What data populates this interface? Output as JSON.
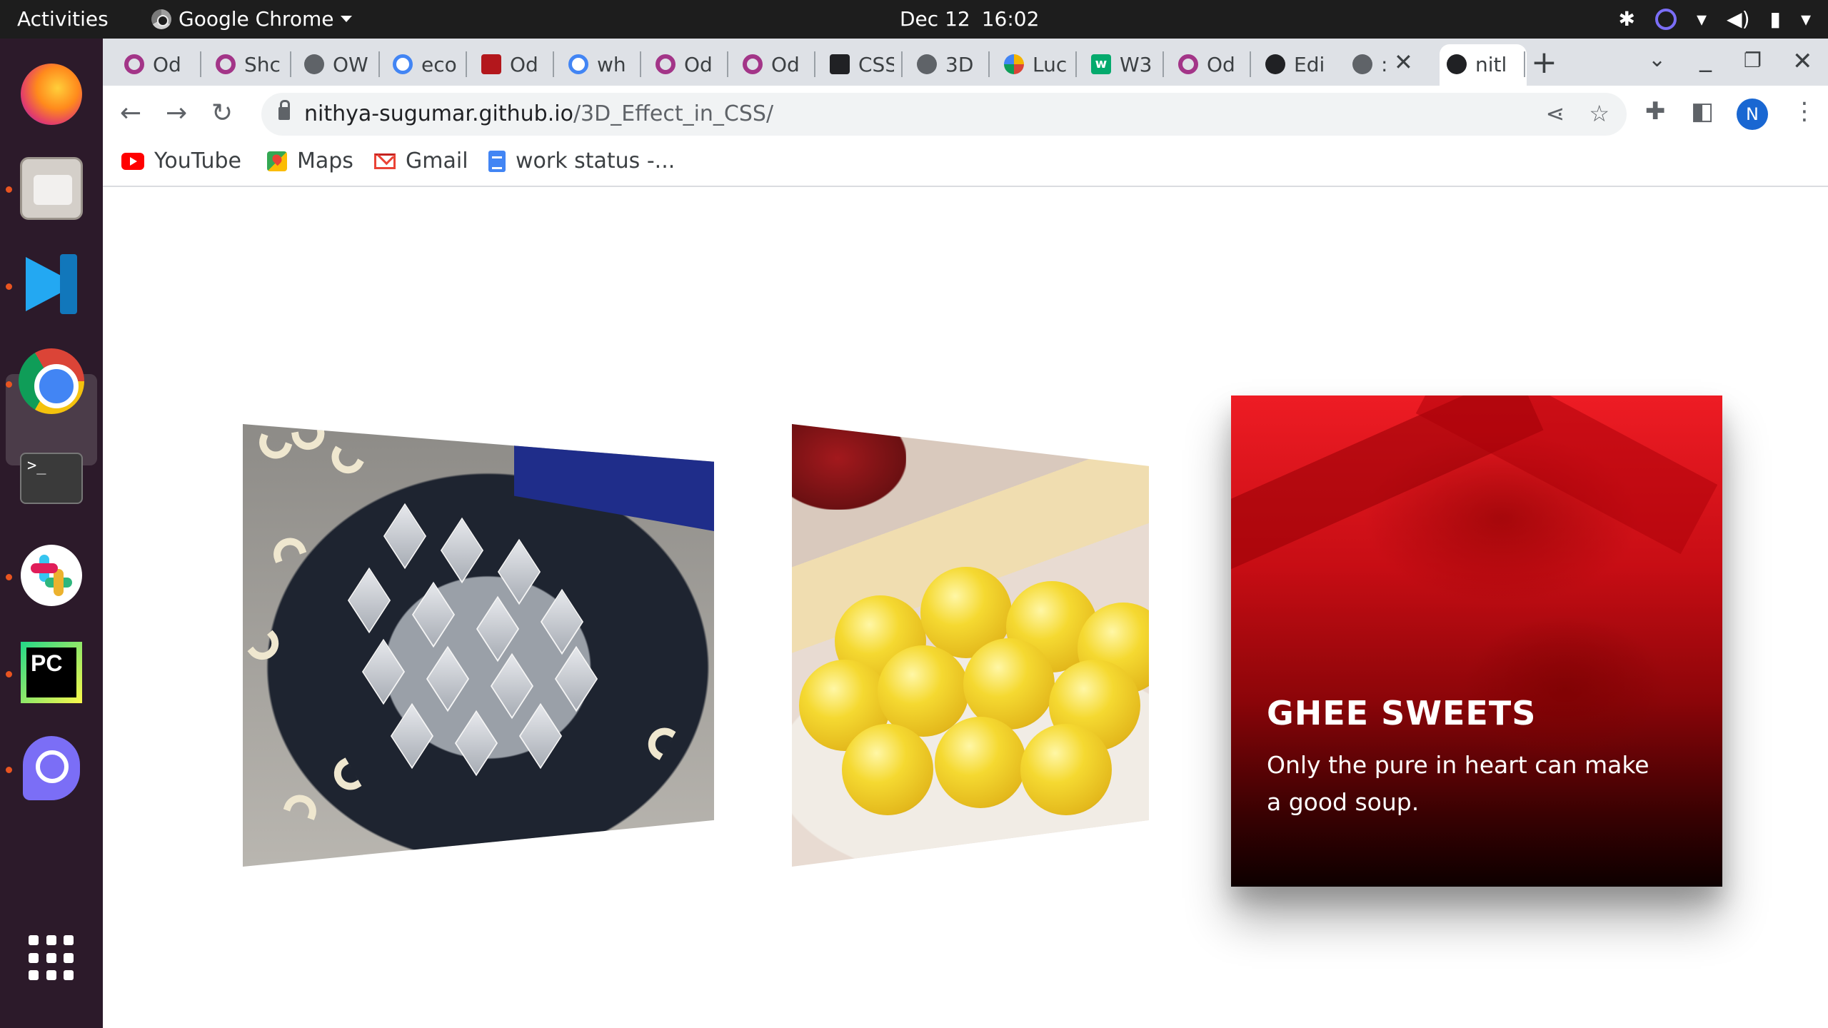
{
  "topbar": {
    "activities": "Activities",
    "app_name": "Google Chrome",
    "date": "Dec 12",
    "time": "16:02",
    "tray_icons": [
      "slack-tray-icon",
      "clock-tray-icon",
      "wifi-icon",
      "volume-icon",
      "battery-icon",
      "system-menu-caret-icon"
    ]
  },
  "dock": {
    "apps": [
      "Firefox",
      "Files",
      "Visual Studio Code",
      "Google Chrome",
      "Terminal",
      "Slack",
      "PyCharm",
      "Clockify",
      "Show Applications"
    ],
    "accent_color": "#e95420"
  },
  "tabs": [
    {
      "label": "Od",
      "icon": "opera-icon"
    },
    {
      "label": "Shc",
      "icon": "opera-icon"
    },
    {
      "label": "OW",
      "icon": "globe-icon"
    },
    {
      "label": "eco",
      "icon": "google-icon"
    },
    {
      "label": "Od",
      "icon": "red-page-icon"
    },
    {
      "label": "wh",
      "icon": "google-icon"
    },
    {
      "label": "Od",
      "icon": "opera-icon"
    },
    {
      "label": "Od",
      "icon": "opera-icon"
    },
    {
      "label": "CSS",
      "icon": "codepen-icon"
    },
    {
      "label": "3D",
      "icon": "globe-icon"
    },
    {
      "label": "Luc",
      "icon": "pinwheel-icon"
    },
    {
      "label": "W3",
      "icon": "w3schools-icon"
    },
    {
      "label": "Od",
      "icon": "opera-icon"
    },
    {
      "label": "Edi",
      "icon": "github-icon"
    },
    {
      "label": ":",
      "icon": "globe-icon",
      "active": true
    },
    {
      "label": "nitl",
      "icon": "github-icon"
    }
  ],
  "toolbar": {
    "url_host": "nithya-sugumar.github.io",
    "url_path": "/3D_Effect_in_CSS/",
    "profile_initial": "N"
  },
  "bookmarks": [
    {
      "label": "YouTube",
      "icon": "youtube-icon"
    },
    {
      "label": "Maps",
      "icon": "maps-icon"
    },
    {
      "label": "Gmail",
      "icon": "gmail-icon"
    },
    {
      "label": "work status -...",
      "icon": "docs-icon"
    }
  ],
  "cards": {
    "front": {
      "title": "GHEE SWEETS",
      "text": "Only the pure in heart can make a good soup.",
      "color": "#c70d14"
    }
  }
}
